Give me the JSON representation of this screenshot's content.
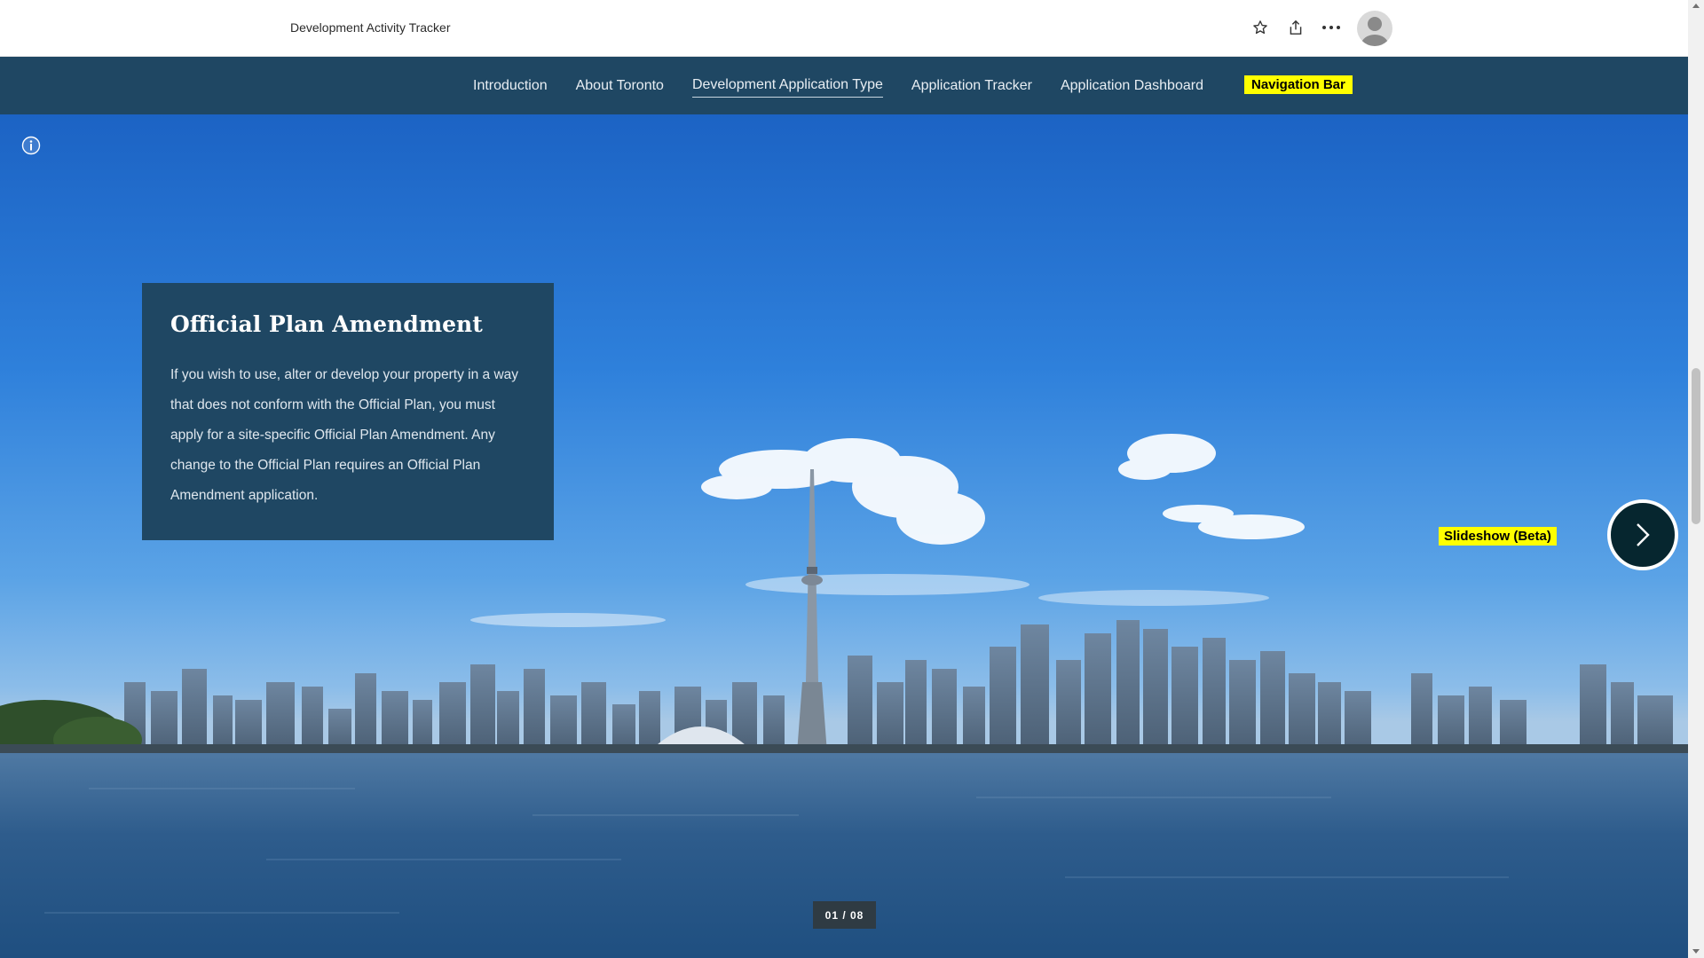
{
  "app": {
    "title": "Development Activity Tracker"
  },
  "header": {
    "icons": [
      "star-icon",
      "share-icon",
      "more-icon",
      "user-avatar"
    ]
  },
  "nav": {
    "items": [
      {
        "label": "Introduction"
      },
      {
        "label": "About Toronto"
      },
      {
        "label": "Development Application Type",
        "active": true
      },
      {
        "label": "Application Tracker"
      },
      {
        "label": "Application Dashboard"
      }
    ],
    "tag": "Navigation Bar"
  },
  "slide": {
    "title": "Official Plan Amendment",
    "body": "If you wish to use, alter or develop your property in a way that does not conform with the Official Plan, you must apply for a site-specific Official Plan Amendment. Any change to the Official Plan requires an Official Plan Amendment application.",
    "counter": "01 / 08",
    "tag": "Slideshow (Beta)"
  },
  "colors": {
    "nav_bg": "#1f4763",
    "card_bg": "#1f4763",
    "tag_bg": "#ffff00",
    "next_btn_bg": "#06262f"
  }
}
